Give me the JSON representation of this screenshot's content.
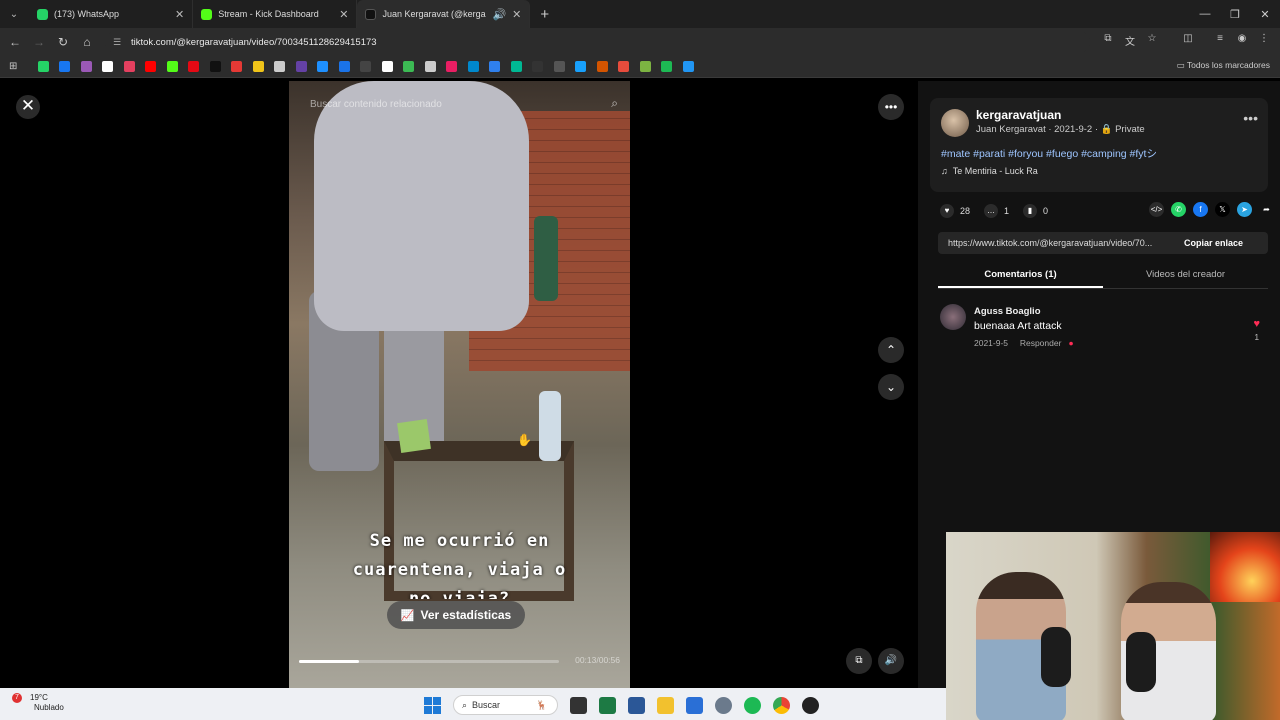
{
  "browser": {
    "tabs": [
      {
        "title": "(173) WhatsApp",
        "color": "#25d366",
        "active": false
      },
      {
        "title": "Stream - Kick Dashboard",
        "color": "#53fc18",
        "active": false
      },
      {
        "title": "Juan Kergaravat (@kergara",
        "color": "#111111",
        "active": true
      }
    ],
    "url": "tiktok.com/@kergaravatjuan/video/7003451128629415173",
    "bookmarks_all_label": "Todos los marcadores",
    "bookmark_colors": [
      "#25d366",
      "#1877f2",
      "#9b59b6",
      "#ffffff",
      "#e4405f",
      "#ff0000",
      "#53fc18",
      "#e50914",
      "#111111",
      "#e53935",
      "#f0c419",
      "#cccccc",
      "#6441a5",
      "#1e90ff",
      "#1a73e8",
      "#444444",
      "#ffffff",
      "#3cba54",
      "#cccccc",
      "#e91e63",
      "#0088cc",
      "#2f80ed",
      "#00b894",
      "#333333",
      "#555555",
      "#18a0fb",
      "#d35400",
      "#e74c3c",
      "#7cb342",
      "#1db954",
      "#2196f3"
    ]
  },
  "video": {
    "search_placeholder": "Buscar contenido relacionado",
    "caption_lines": [
      "Se me ocurrió en",
      "cuarentena, viaja o",
      "no viaja?"
    ],
    "stats_button": "Ver estadísticas",
    "time": "00:13/00:56",
    "progress": 0.23
  },
  "post": {
    "username": "kergaravatjuan",
    "meta": "Juan Kergaravat · 2021-9-2 · 🔒 Private",
    "tags": "#mate #parati #foryou #fuego #camping #fytシ",
    "music": "Te Mentiria - Luck Ra",
    "likes": "28",
    "comments": "1",
    "saves": "0",
    "link": "https://www.tiktok.com/@kergaravatjuan/video/70...",
    "copy_label": "Copiar enlace",
    "tab_comments": "Comentarios (1)",
    "tab_videos": "Videos del creador"
  },
  "comment": {
    "author": "Aguss Boaglio",
    "text": "buenaaa Art attack",
    "date": "2021-9-5",
    "reply": "Responder",
    "likes": "1"
  },
  "taskbar": {
    "temp": "19°C",
    "condition": "Nublado",
    "badge": "7",
    "search_label": "Buscar"
  }
}
